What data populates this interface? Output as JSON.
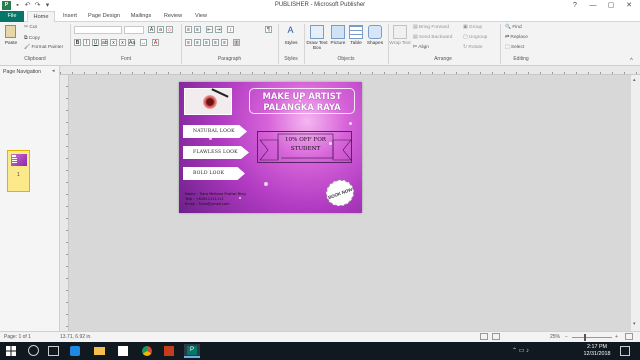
{
  "window": {
    "title": "PUBLISHER - Microsoft Publisher",
    "controls": [
      "?",
      "—",
      "▢",
      "✕"
    ]
  },
  "tabs": [
    "File",
    "Home",
    "Insert",
    "Page Design",
    "Mailings",
    "Review",
    "View"
  ],
  "ribbon": {
    "clipboard": {
      "paste": "Paste",
      "cut": "Cut",
      "copy": "Copy",
      "format_painter": "Format Painter",
      "label": "Clipboard"
    },
    "font": {
      "label": "Font",
      "bold": "B",
      "italic": "I",
      "underline": "U"
    },
    "paragraph": {
      "label": "Paragraph",
      "mark": "¶"
    },
    "styles": {
      "button": "Styles",
      "label": "Styles"
    },
    "objects": {
      "draw_text_box": "Draw Text Box",
      "picture": "Picture",
      "table": "Table",
      "shapes": "Shapes",
      "label": "Objects"
    },
    "arrange": {
      "wrap_text": "Wrap Text",
      "bring_forward": "Bring Forward",
      "send_backward": "Send Backward",
      "align": "Align",
      "group": "Group",
      "ungroup": "Ungroup",
      "rotate": "Rotate",
      "label": "Arrange"
    },
    "editing": {
      "find": "Find",
      "replace": "Replace",
      "select": "Select",
      "label": "Editing"
    }
  },
  "nav": {
    "title": "Page Navigation",
    "page_number": "1"
  },
  "flyer": {
    "title_line1": "MAKE UP ARTIST",
    "title_line2": "PALANGKA RAYA",
    "services": [
      "NATURAL LOOK",
      "FLAWLESS LOOK",
      "BOLD LOOK"
    ],
    "offer_line1": "10% OFF FOR",
    "offer_line2": "STUDENT",
    "badge": "BOOK NOW",
    "contact": [
      "Name : Tiara Meliana Pratiwi Ring",
      "Telp : +62811111111",
      "Email : Tiara@ymail.com"
    ]
  },
  "status": {
    "page": "Page: 1 of 1",
    "coords": "13.71, 6.92 in.",
    "zoom": "25%"
  },
  "taskbar": {
    "time": "2:17 PM",
    "date": "12/31/2018"
  }
}
